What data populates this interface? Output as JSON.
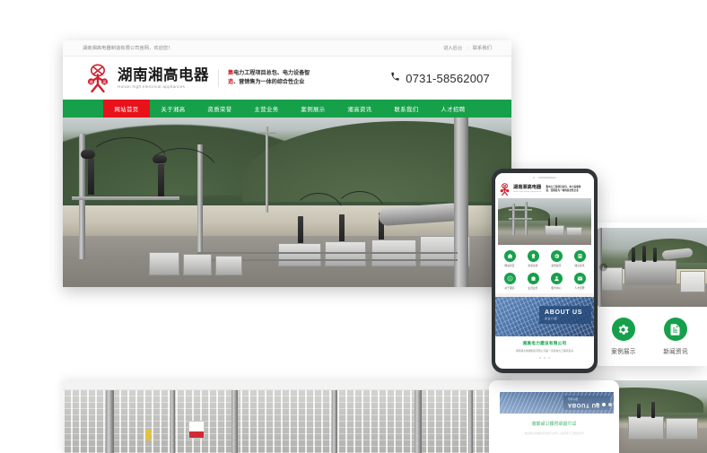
{
  "meta": {
    "accent_green": "#16a04b",
    "accent_red": "#e8121a",
    "logo_red": "#cf2030",
    "background": "#ffffff"
  },
  "desktop": {
    "topbar": {
      "notice": "湖南湘高电器制造有限公司官网，欢迎您！",
      "links": [
        "进入后台",
        "联系我们"
      ],
      "separator": "|"
    },
    "header": {
      "logo_icon": "brand-figure-logo",
      "brand_cn": "湖南湘高电器",
      "brand_en": "Hunan high electrical appliances",
      "slogan_line1_prefix": "集",
      "slogan_line1_strong": "电力工程项目总包、电力设备智",
      "slogan_line2_prefix": "造",
      "slogan_line2_strong": "、营销售为一体的综合性企业",
      "phone_icon": "phone-icon",
      "phone": "0731-58562007"
    },
    "nav": {
      "items": [
        {
          "label": "网站首页",
          "active": true
        },
        {
          "label": "关于湘高",
          "active": false
        },
        {
          "label": "资质荣誉",
          "active": false
        },
        {
          "label": "主营业务",
          "active": false
        },
        {
          "label": "案例展示",
          "active": false
        },
        {
          "label": "湘高资讯",
          "active": false
        },
        {
          "label": "联系我们",
          "active": false
        },
        {
          "label": "人才招聘",
          "active": false
        }
      ]
    },
    "hero": {
      "alt": "电力变电站高压开关设备实景图"
    }
  },
  "desktop2": {
    "hero_alt": "变电站构架与设备实景图",
    "sign_label": "警示牌"
  },
  "phone": {
    "header": {
      "logo_icon": "brand-figure-logo",
      "brand_cn": "湖南湘高电器",
      "brand_en": "Hunan high electrical appliances",
      "slogan1": "集电力工程项目总包、电力设备智",
      "slogan2": "造、营销售为一体的综合性企业"
    },
    "hero_alt": "变电站铁塔设备实景图",
    "grid": [
      {
        "label": "网站首页",
        "icon": "home-icon"
      },
      {
        "label": "资质荣誉",
        "icon": "award-icon"
      },
      {
        "label": "案例展示",
        "icon": "gear-icon"
      },
      {
        "label": "湘高资讯",
        "icon": "news-icon"
      },
      {
        "label": "关于湘高",
        "icon": "info-icon"
      },
      {
        "label": "主营业务",
        "icon": "briefcase-icon"
      },
      {
        "label": "服务中心",
        "icon": "user-icon"
      },
      {
        "label": "人才招聘",
        "icon": "mail-icon"
      }
    ],
    "about": {
      "title_en": "ABOUT US",
      "title_cn": "企业介绍",
      "company": "湘高电力建设有限公司",
      "desc": "湖南湘高电器制造有限公司是一家集电力工程项目总"
    }
  },
  "right_card": {
    "photo_alt": "变压器与高压设备实景图",
    "prev_arrow": "chevron-left-icon",
    "tiles": [
      {
        "label": "案例展示",
        "icon": "gear-icon"
      },
      {
        "label": "新闻资讯",
        "icon": "document-icon"
      }
    ]
  },
  "reflection": {
    "company": "湘高电力建设有限公司",
    "desc": "湖南湘高电器制造有限公司是一家集电力工程项目总",
    "banner_title": "ABOUT US",
    "banner_sub": "企业介绍",
    "dots": 3,
    "active_dot": 2
  }
}
